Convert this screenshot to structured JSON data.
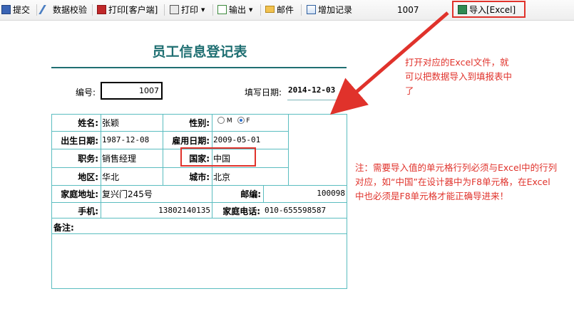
{
  "toolbar": {
    "submit": "提交",
    "validate": "数据校验",
    "print_client": "打印[客户端]",
    "print": "打印",
    "export": "输出",
    "mail": "邮件",
    "add_record": "增加记录",
    "record_no": "1007",
    "import_excel": "导入[Excel]"
  },
  "form": {
    "title": "员工信息登记表",
    "no_label": "编号:",
    "no_value": "1007",
    "date_label": "填写日期:",
    "date_value": "2014-12-03",
    "name_label": "姓名:",
    "name_value": "张颖",
    "gender_label": "性别:",
    "gender_m": "M",
    "gender_f": "F",
    "gender_selected": "F",
    "birth_label": "出生日期:",
    "birth_value": "1987-12-08",
    "hire_label": "雇用日期:",
    "hire_value": "2009-05-01",
    "position_label": "职务:",
    "position_value": "销售经理",
    "country_label": "国家:",
    "country_value": "中国",
    "region_label": "地区:",
    "region_value": "华北",
    "city_label": "城市:",
    "city_value": "北京",
    "address_label": "家庭地址:",
    "address_value": "复兴门245号",
    "postcode_label": "邮编:",
    "postcode_value": "100098",
    "mobile_label": "手机:",
    "mobile_value": "13802140135",
    "phone_label": "家庭电话:",
    "phone_value": "010-655598587",
    "remark_label": "备注:"
  },
  "annotations": {
    "import_note": "打开对应的Excel文件，就可以把数据导入到填报表中了",
    "cell_note": "注：需要导入值的单元格行列必须与Excel中的行列对应，如“中国”在设计器中为F8单元格，在Excel中也必须是F8单元格才能正确导进来！"
  },
  "colors": {
    "accent": "#1f6f72",
    "grid": "#5bbdc0",
    "annotation": "#e0322b"
  }
}
